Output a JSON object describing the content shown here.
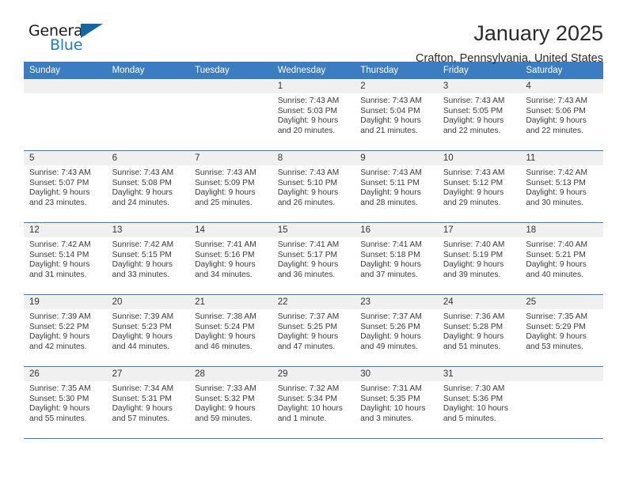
{
  "logo": {
    "word1": "General",
    "word2": "Blue",
    "triangle_color": "#15659f",
    "blue_text_color": "#1f7fc4"
  },
  "header": {
    "title": "January 2025",
    "subtitle": "Crafton, Pennsylvania, United States"
  },
  "theme": {
    "header_blue": "#3b7dc0",
    "daynum_gray": "#f0f0f0"
  },
  "weekdays": [
    "Sunday",
    "Monday",
    "Tuesday",
    "Wednesday",
    "Thursday",
    "Friday",
    "Saturday"
  ],
  "weeks": [
    [
      {
        "day": "",
        "empty": true
      },
      {
        "day": "",
        "empty": true
      },
      {
        "day": "",
        "empty": true
      },
      {
        "day": "1",
        "sunrise": "Sunrise: 7:43 AM",
        "sunset": "Sunset: 5:03 PM",
        "daylight": "Daylight: 9 hours and 20 minutes."
      },
      {
        "day": "2",
        "sunrise": "Sunrise: 7:43 AM",
        "sunset": "Sunset: 5:04 PM",
        "daylight": "Daylight: 9 hours and 21 minutes."
      },
      {
        "day": "3",
        "sunrise": "Sunrise: 7:43 AM",
        "sunset": "Sunset: 5:05 PM",
        "daylight": "Daylight: 9 hours and 22 minutes."
      },
      {
        "day": "4",
        "sunrise": "Sunrise: 7:43 AM",
        "sunset": "Sunset: 5:06 PM",
        "daylight": "Daylight: 9 hours and 22 minutes."
      }
    ],
    [
      {
        "day": "5",
        "sunrise": "Sunrise: 7:43 AM",
        "sunset": "Sunset: 5:07 PM",
        "daylight": "Daylight: 9 hours and 23 minutes."
      },
      {
        "day": "6",
        "sunrise": "Sunrise: 7:43 AM",
        "sunset": "Sunset: 5:08 PM",
        "daylight": "Daylight: 9 hours and 24 minutes."
      },
      {
        "day": "7",
        "sunrise": "Sunrise: 7:43 AM",
        "sunset": "Sunset: 5:09 PM",
        "daylight": "Daylight: 9 hours and 25 minutes."
      },
      {
        "day": "8",
        "sunrise": "Sunrise: 7:43 AM",
        "sunset": "Sunset: 5:10 PM",
        "daylight": "Daylight: 9 hours and 26 minutes."
      },
      {
        "day": "9",
        "sunrise": "Sunrise: 7:43 AM",
        "sunset": "Sunset: 5:11 PM",
        "daylight": "Daylight: 9 hours and 28 minutes."
      },
      {
        "day": "10",
        "sunrise": "Sunrise: 7:43 AM",
        "sunset": "Sunset: 5:12 PM",
        "daylight": "Daylight: 9 hours and 29 minutes."
      },
      {
        "day": "11",
        "sunrise": "Sunrise: 7:42 AM",
        "sunset": "Sunset: 5:13 PM",
        "daylight": "Daylight: 9 hours and 30 minutes."
      }
    ],
    [
      {
        "day": "12",
        "sunrise": "Sunrise: 7:42 AM",
        "sunset": "Sunset: 5:14 PM",
        "daylight": "Daylight: 9 hours and 31 minutes."
      },
      {
        "day": "13",
        "sunrise": "Sunrise: 7:42 AM",
        "sunset": "Sunset: 5:15 PM",
        "daylight": "Daylight: 9 hours and 33 minutes."
      },
      {
        "day": "14",
        "sunrise": "Sunrise: 7:41 AM",
        "sunset": "Sunset: 5:16 PM",
        "daylight": "Daylight: 9 hours and 34 minutes."
      },
      {
        "day": "15",
        "sunrise": "Sunrise: 7:41 AM",
        "sunset": "Sunset: 5:17 PM",
        "daylight": "Daylight: 9 hours and 36 minutes."
      },
      {
        "day": "16",
        "sunrise": "Sunrise: 7:41 AM",
        "sunset": "Sunset: 5:18 PM",
        "daylight": "Daylight: 9 hours and 37 minutes."
      },
      {
        "day": "17",
        "sunrise": "Sunrise: 7:40 AM",
        "sunset": "Sunset: 5:19 PM",
        "daylight": "Daylight: 9 hours and 39 minutes."
      },
      {
        "day": "18",
        "sunrise": "Sunrise: 7:40 AM",
        "sunset": "Sunset: 5:21 PM",
        "daylight": "Daylight: 9 hours and 40 minutes."
      }
    ],
    [
      {
        "day": "19",
        "sunrise": "Sunrise: 7:39 AM",
        "sunset": "Sunset: 5:22 PM",
        "daylight": "Daylight: 9 hours and 42 minutes."
      },
      {
        "day": "20",
        "sunrise": "Sunrise: 7:39 AM",
        "sunset": "Sunset: 5:23 PM",
        "daylight": "Daylight: 9 hours and 44 minutes."
      },
      {
        "day": "21",
        "sunrise": "Sunrise: 7:38 AM",
        "sunset": "Sunset: 5:24 PM",
        "daylight": "Daylight: 9 hours and 46 minutes."
      },
      {
        "day": "22",
        "sunrise": "Sunrise: 7:37 AM",
        "sunset": "Sunset: 5:25 PM",
        "daylight": "Daylight: 9 hours and 47 minutes."
      },
      {
        "day": "23",
        "sunrise": "Sunrise: 7:37 AM",
        "sunset": "Sunset: 5:26 PM",
        "daylight": "Daylight: 9 hours and 49 minutes."
      },
      {
        "day": "24",
        "sunrise": "Sunrise: 7:36 AM",
        "sunset": "Sunset: 5:28 PM",
        "daylight": "Daylight: 9 hours and 51 minutes."
      },
      {
        "day": "25",
        "sunrise": "Sunrise: 7:35 AM",
        "sunset": "Sunset: 5:29 PM",
        "daylight": "Daylight: 9 hours and 53 minutes."
      }
    ],
    [
      {
        "day": "26",
        "sunrise": "Sunrise: 7:35 AM",
        "sunset": "Sunset: 5:30 PM",
        "daylight": "Daylight: 9 hours and 55 minutes."
      },
      {
        "day": "27",
        "sunrise": "Sunrise: 7:34 AM",
        "sunset": "Sunset: 5:31 PM",
        "daylight": "Daylight: 9 hours and 57 minutes."
      },
      {
        "day": "28",
        "sunrise": "Sunrise: 7:33 AM",
        "sunset": "Sunset: 5:32 PM",
        "daylight": "Daylight: 9 hours and 59 minutes."
      },
      {
        "day": "29",
        "sunrise": "Sunrise: 7:32 AM",
        "sunset": "Sunset: 5:34 PM",
        "daylight": "Daylight: 10 hours and 1 minute."
      },
      {
        "day": "30",
        "sunrise": "Sunrise: 7:31 AM",
        "sunset": "Sunset: 5:35 PM",
        "daylight": "Daylight: 10 hours and 3 minutes."
      },
      {
        "day": "31",
        "sunrise": "Sunrise: 7:30 AM",
        "sunset": "Sunset: 5:36 PM",
        "daylight": "Daylight: 10 hours and 5 minutes."
      },
      {
        "day": "",
        "empty": true
      }
    ]
  ]
}
